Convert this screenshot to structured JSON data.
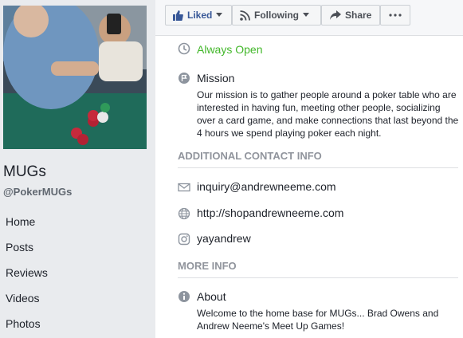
{
  "sidebar": {
    "page_name": "MUGs",
    "page_handle": "@PokerMUGs",
    "nav": [
      {
        "label": "Home"
      },
      {
        "label": "Posts"
      },
      {
        "label": "Reviews"
      },
      {
        "label": "Videos"
      },
      {
        "label": "Photos"
      }
    ]
  },
  "actions": {
    "liked_label": "Liked",
    "following_label": "Following",
    "share_label": "Share"
  },
  "about": {
    "hours": "Always Open",
    "mission_title": "Mission",
    "mission_text": "Our mission is to gather people around a poker table who are interested in having fun, meeting other people, socializing over a card game, and make connections that last beyond the 4 hours we spend playing poker each night.",
    "contact_heading": "ADDITIONAL CONTACT INFO",
    "email": "inquiry@andrewneeme.com",
    "website": "http://shopandrewneeme.com",
    "instagram": "yayandrew",
    "more_heading": "MORE INFO",
    "about_title": "About",
    "about_text": "Welcome to the home base for MUGs... Brad Owens and Andrew Neeme's Meet Up Games!"
  },
  "icons": {
    "liked": "thumbs-up-icon",
    "following": "rss-feed-icon",
    "share": "share-arrow-icon",
    "more": "more-dots-icon",
    "hours": "clock-icon",
    "mission": "flag-icon",
    "email": "envelope-icon",
    "website": "globe-icon",
    "instagram": "instagram-icon",
    "about": "info-icon"
  },
  "colors": {
    "brand_blue": "#385898",
    "open_green": "#42b72a",
    "muted_text": "#90949c",
    "sidebar_bg": "#e9ebee"
  }
}
